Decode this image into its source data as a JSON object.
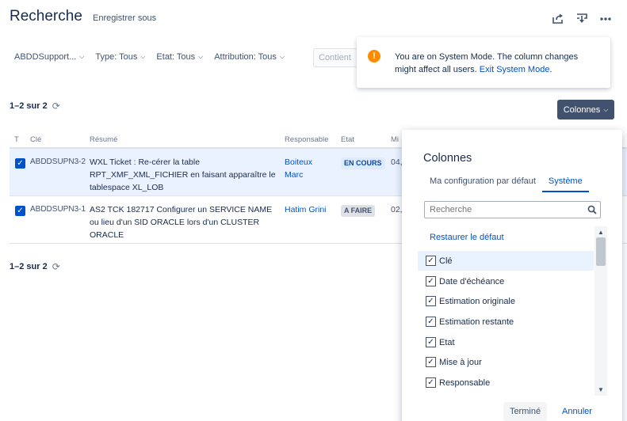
{
  "page": {
    "title": "Recherche",
    "save_as": "Enregistrer sous"
  },
  "filters": {
    "project": "ABDDSupport...",
    "type": "Type: Tous",
    "status": "Etat: Tous",
    "assignee": "Attribution: Tous",
    "contains_placeholder": "Contient"
  },
  "banner": {
    "message": "You are on System Mode. The column changes might affect all users.",
    "link": "Exit System Mode",
    "tail": "."
  },
  "count_top": "1–2 sur 2",
  "count_bottom": "1–2 sur 2",
  "columns_button": "Colonnes",
  "table": {
    "headers": [
      "T",
      "Clé",
      "Résumé",
      "Responsable",
      "Etat",
      "Mi"
    ],
    "rows": [
      {
        "key": "ABDDSUPN3-2",
        "summary": "WXL Ticket : Re-cérer la table RPT_XMF_XML_FICHIER en faisant apparaître le tablespace XL_LOB",
        "assignee": "Boiteux Marc",
        "status": "EN COURS",
        "updated": "04,"
      },
      {
        "key": "ABDDSUPN3-1",
        "summary": "AS2 TCK 182717 Configurer un SERVICE NAME ou lieu d'un SID ORACLE lors d'un CLUSTER ORACLE",
        "assignee": "Hatim Grini",
        "status": "A FAIRE",
        "updated": "02,"
      }
    ]
  },
  "columns_panel": {
    "title": "Colonnes",
    "tabs": [
      "Ma configuration par défaut",
      "Système"
    ],
    "active_tab": "Système",
    "search_placeholder": "Recherche",
    "restore": "Restaurer le défaut",
    "items": [
      "Clé",
      "Date d'échéance",
      "Estimation originale",
      "Estimation restante",
      "Etat",
      "Mise à jour",
      "Responsable"
    ],
    "done": "Terminé",
    "cancel": "Annuler"
  },
  "colors": {
    "accent": "#0052cc",
    "button_dark": "#42526e",
    "warning": "#ff8b00"
  }
}
